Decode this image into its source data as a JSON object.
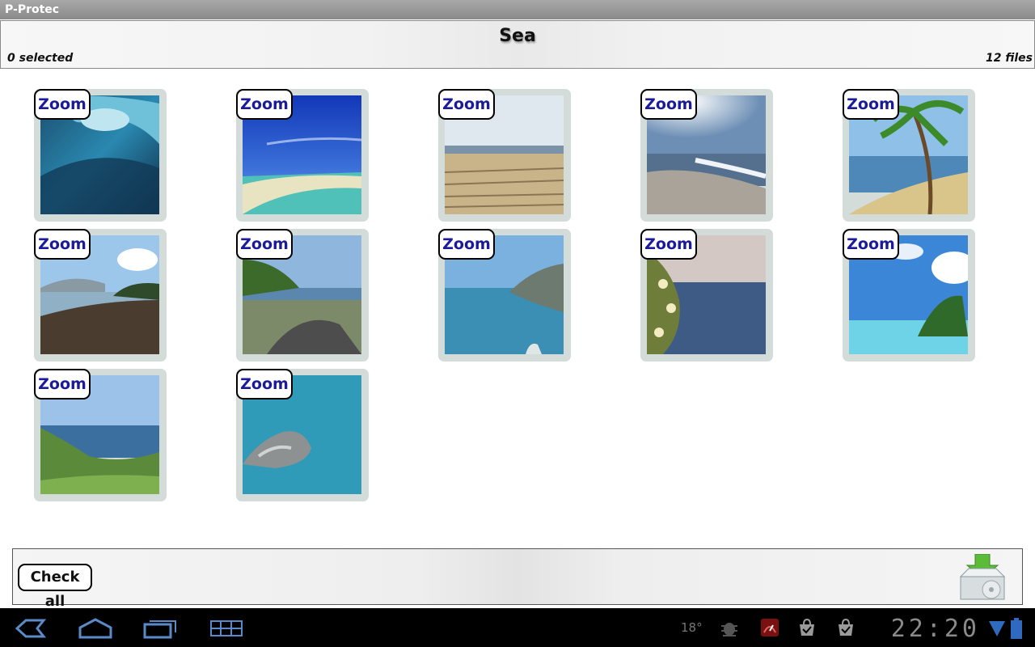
{
  "app_title": "P-Protec",
  "header": {
    "title": "Sea",
    "selected_count": "0 selected",
    "file_count": "12 files"
  },
  "thumbnails": [
    {
      "zoom_label": "Zoom",
      "scene": "wave-curl"
    },
    {
      "zoom_label": "Zoom",
      "scene": "tropical-sandbar"
    },
    {
      "zoom_label": "Zoom",
      "scene": "sandy-beach"
    },
    {
      "zoom_label": "Zoom",
      "scene": "sunlit-shore"
    },
    {
      "zoom_label": "Zoom",
      "scene": "palm-beach"
    },
    {
      "zoom_label": "Zoom",
      "scene": "dark-sand-bay"
    },
    {
      "zoom_label": "Zoom",
      "scene": "rocky-coast"
    },
    {
      "zoom_label": "Zoom",
      "scene": "cliff-coast"
    },
    {
      "zoom_label": "Zoom",
      "scene": "flowers-sea"
    },
    {
      "zoom_label": "Zoom",
      "scene": "island-palms"
    },
    {
      "zoom_label": "Zoom",
      "scene": "green-hill-coast"
    },
    {
      "zoom_label": "Zoom",
      "scene": "rock-in-sea"
    }
  ],
  "footer": {
    "check_all_label": "Check all",
    "export_icon": "archive-export-icon"
  },
  "system_bar": {
    "nav_icons": [
      "back-icon",
      "home-icon",
      "recent-apps-icon",
      "grid-icon"
    ],
    "temperature": "18°",
    "clock": "22:20",
    "status_icons": [
      "android-debug-icon",
      "speedometer-icon",
      "shopping-bag-check-icon",
      "shopping-bag-check-icon",
      "wifi-icon",
      "battery-icon"
    ]
  },
  "colors": {
    "zoom_text": "#1a1a9a",
    "tile_frame": "#d4dcda"
  }
}
